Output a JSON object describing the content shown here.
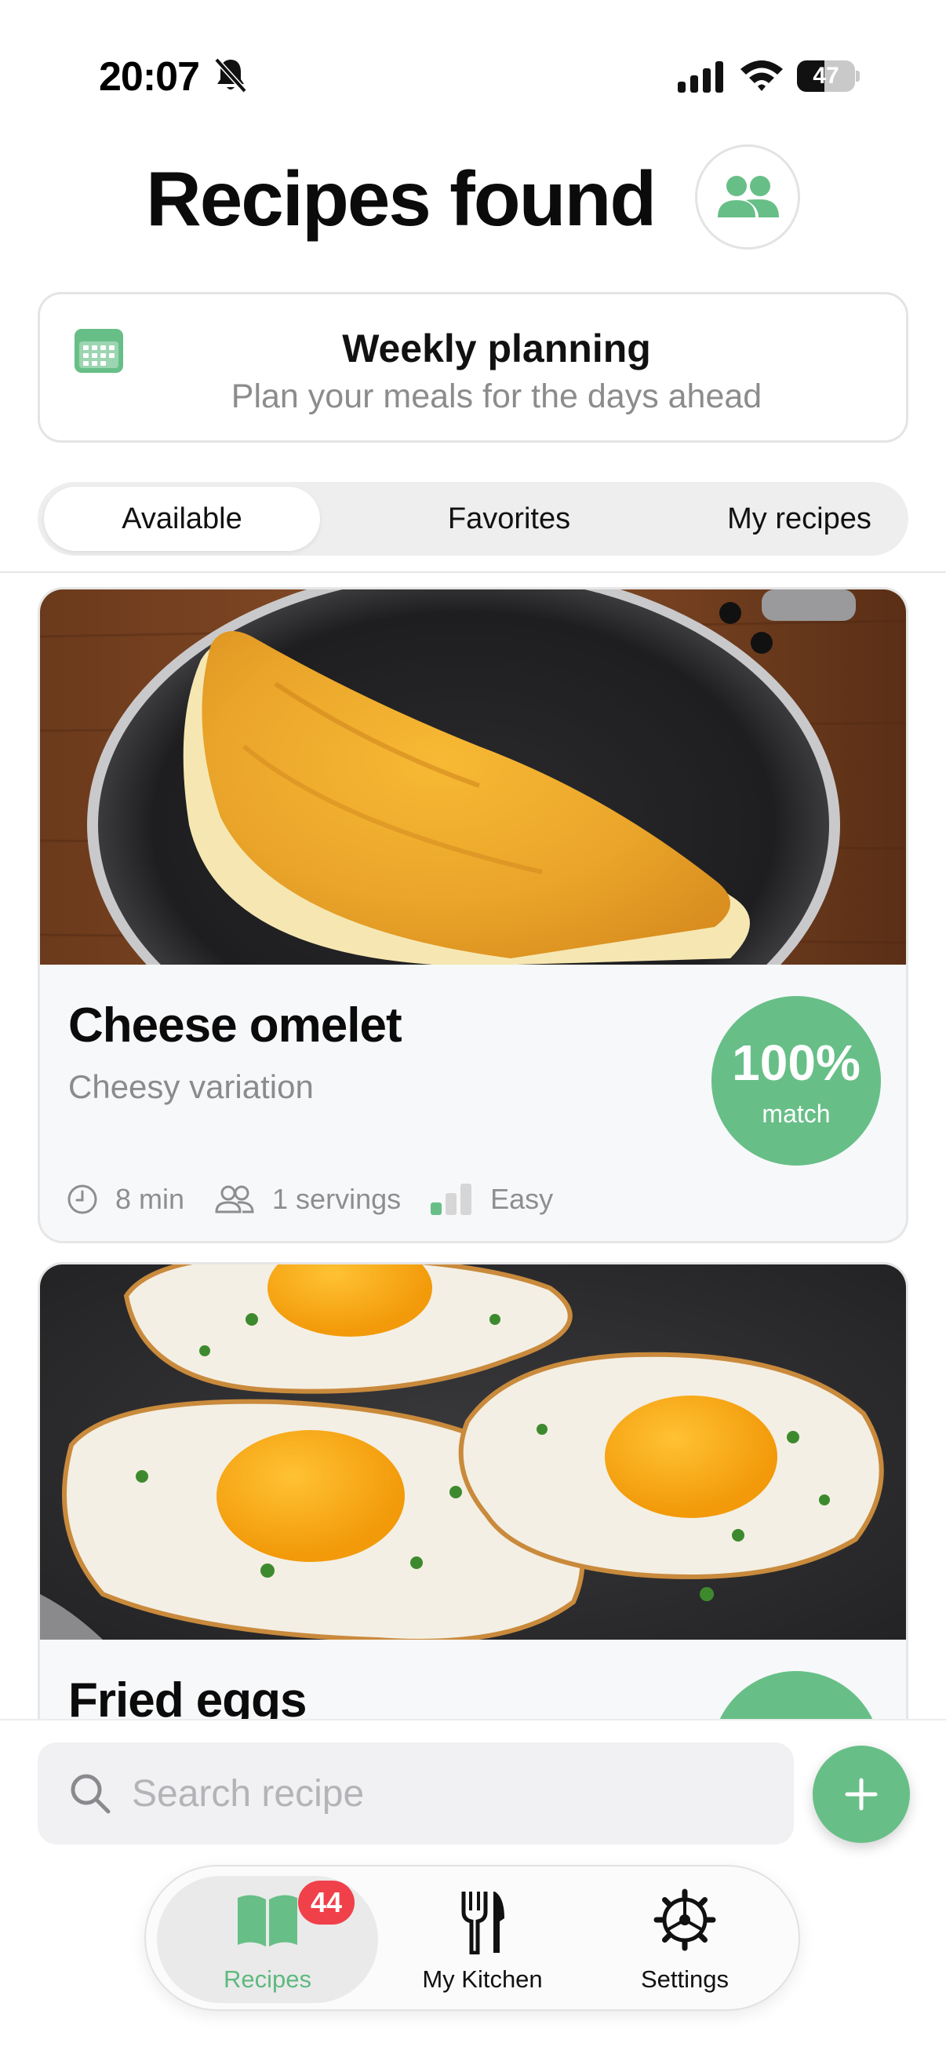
{
  "status_bar": {
    "time": "20:07",
    "battery": "47",
    "battery_level": 0.47
  },
  "header": {
    "title": "Recipes found",
    "household_icon": "people-icon"
  },
  "planning": {
    "title": "Weekly planning",
    "subtitle": "Plan your meals for the days ahead",
    "icon": "calendar-icon"
  },
  "tabs": {
    "available": "Available",
    "favorites": "Favorites",
    "my_recipes": "My recipes",
    "selected": "Available"
  },
  "recipes": [
    {
      "name": "Cheese omelet",
      "variant": "Cheesy variation",
      "match_pct": "100%",
      "match_label": "match",
      "time": "8 min",
      "servings": "1 servings",
      "difficulty": "Easy",
      "image": "omelet-in-pan"
    },
    {
      "name": "Fried eggs",
      "image": "fried-eggs-in-pan"
    }
  ],
  "search": {
    "placeholder": "Search recipe"
  },
  "bottom_nav": {
    "recipes": "Recipes",
    "recipes_badge": "44",
    "kitchen": "My Kitchen",
    "settings": "Settings",
    "active": "Recipes"
  },
  "colors": {
    "accent": "#67bf87",
    "badge": "#f0404a"
  }
}
